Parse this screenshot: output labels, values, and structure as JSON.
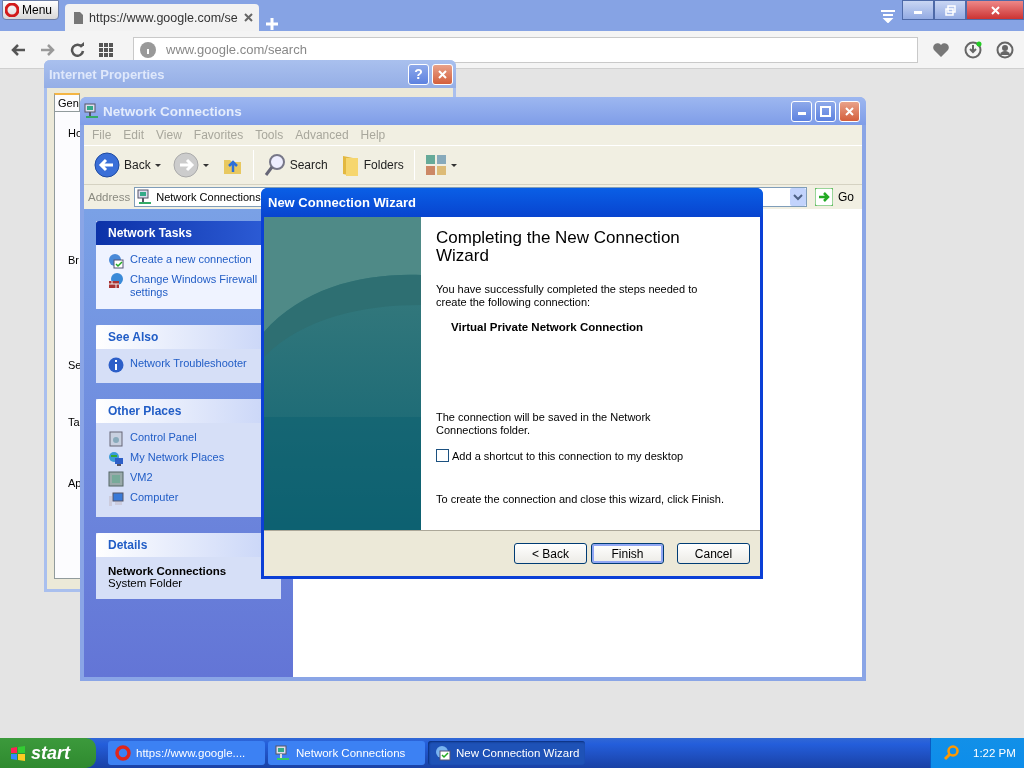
{
  "browser": {
    "menu_button": "Menu",
    "tabs": [
      {
        "title": "https://www.google.com/se",
        "selected": true
      }
    ],
    "address": "www.google.com/search"
  },
  "internet_properties": {
    "title": "Internet Properties",
    "help_button": "?",
    "tab": "Gen",
    "labels": [
      "Ho",
      "Br",
      "Se",
      "Ta",
      "Ap"
    ]
  },
  "network_connections": {
    "title": "Network Connections",
    "menu": [
      "File",
      "Edit",
      "View",
      "Favorites",
      "Tools",
      "Advanced",
      "Help"
    ],
    "toolbar": [
      {
        "kind": "back",
        "label": "Back",
        "separator_before": false
      },
      {
        "kind": "forward",
        "separator_before": false
      },
      {
        "kind": "up",
        "separator_before": false
      },
      {
        "kind": "search",
        "label": "Search",
        "separator_before": true
      },
      {
        "kind": "folders",
        "label": "Folders",
        "separator_before": false
      },
      {
        "kind": "views",
        "separator_before": true
      }
    ],
    "address_label": "Address",
    "address": "Network Connections",
    "go": "Go",
    "panels": [
      {
        "kind": "special",
        "title": "Network Tasks",
        "items": [
          {
            "kind": "wizard",
            "label": "Create a new connection"
          },
          {
            "kind": "firewall",
            "label": "Change Windows Firewall settings"
          }
        ]
      },
      {
        "kind": "normal",
        "title": "See Also",
        "items": [
          {
            "kind": "info",
            "label": "Network Troubleshooter"
          }
        ]
      },
      {
        "kind": "normal",
        "title": "Other Places",
        "items": [
          {
            "kind": "control-panel",
            "label": "Control Panel"
          },
          {
            "kind": "network-places",
            "label": "My Network Places"
          },
          {
            "kind": "drive",
            "label": "VM2"
          },
          {
            "kind": "computer",
            "label": "Computer"
          }
        ]
      },
      {
        "kind": "details",
        "title": "Details",
        "name": "Network Connections",
        "description": "System Folder"
      }
    ]
  },
  "wizard": {
    "title": "New Connection Wizard",
    "heading": "Completing the New Connection Wizard",
    "intro": "You have successfully completed the steps needed to create the following connection:",
    "connection": "Virtual Private Network Connection",
    "saved_note": "The connection will be saved in the Network Connections folder.",
    "shortcut": {
      "label": "Add a shortcut to this connection to my desktop",
      "checked": false
    },
    "finish_note": "To create the connection and close this wizard, click Finish.",
    "buttons": [
      {
        "label": "< Back",
        "default": false
      },
      {
        "label": "Finish",
        "default": true
      },
      {
        "label": "Cancel",
        "default": false
      }
    ]
  },
  "taskbar": {
    "start": "start",
    "items": [
      {
        "kind": "browser",
        "label": "https://www.google....",
        "selected": false
      },
      {
        "kind": "folder",
        "label": "Network Connections",
        "selected": false
      },
      {
        "kind": "wizard",
        "label": "New Connection Wizard",
        "selected": true
      }
    ],
    "clock": "1:22 PM"
  }
}
